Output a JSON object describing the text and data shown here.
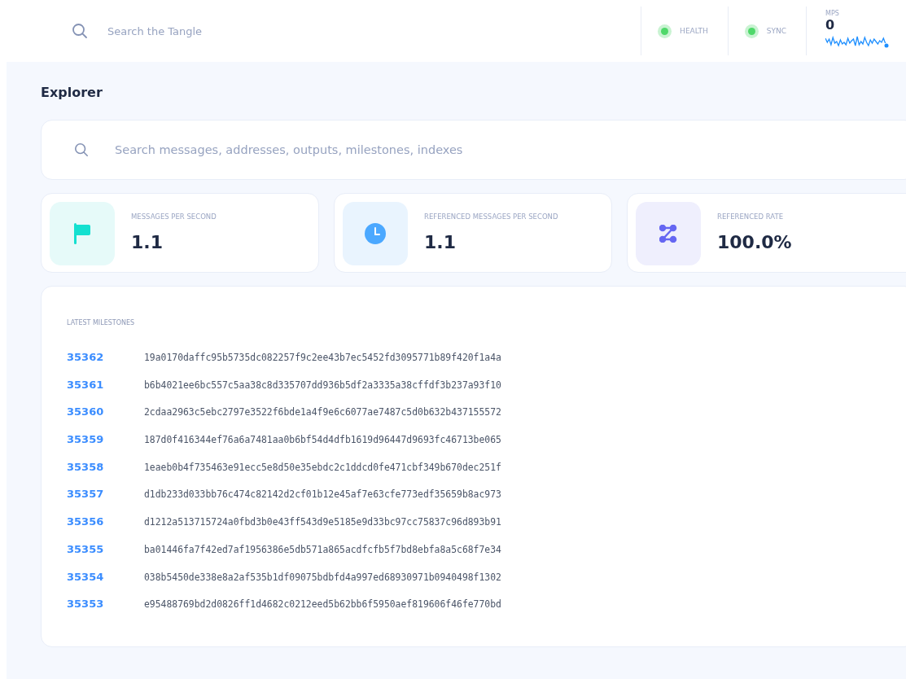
{
  "header": {
    "search": {
      "placeholder": "Search the Tangle"
    },
    "statuses": [
      {
        "label": "HEALTH",
        "healthy": true
      },
      {
        "label": "SYNC",
        "healthy": true
      }
    ],
    "mps": {
      "label": "MPS",
      "value": "0"
    }
  },
  "page_title": "Explorer",
  "search": {
    "placeholder": "Search messages, addresses, outputs, milestones, indexes"
  },
  "stats": [
    {
      "kind": "flag",
      "label": "MESSAGES PER SECOND",
      "value": "1.1"
    },
    {
      "kind": "clock",
      "label": "REFERENCED MESSAGES PER SECOND",
      "value": "1.1"
    },
    {
      "kind": "nodes",
      "label": "REFERENCED RATE",
      "value": "100.0%"
    }
  ],
  "milestones": {
    "title": "LATEST MILESTONES",
    "rows": [
      {
        "index": "35362",
        "id": "19a0170daffc95b5735dc082257f9c2ee43b7ec5452fd3095771b89f420f1a4a"
      },
      {
        "index": "35361",
        "id": "b6b4021ee6bc557c5aa38c8d335707dd936b5df2a3335a38cffdf3b237a93f10"
      },
      {
        "index": "35360",
        "id": "2cdaa2963c5ebc2797e3522f6bde1a4f9e6c6077ae7487c5d0b632b437155572"
      },
      {
        "index": "35359",
        "id": "187d0f416344ef76a6a7481aa0b6bf54d4dfb1619d96447d9693fc46713be065"
      },
      {
        "index": "35358",
        "id": "1eaeb0b4f735463e91ecc5e8d50e35ebdc2c1ddcd0fe471cbf349b670dec251f"
      },
      {
        "index": "35357",
        "id": "d1db233d033bb76c474c82142d2cf01b12e45af7e63cfe773edf35659b8ac973"
      },
      {
        "index": "35356",
        "id": "d1212a513715724a0fbd3b0e43ff543d9e5185e9d33bc97cc75837c96d893b91"
      },
      {
        "index": "35355",
        "id": "ba01446fa7f42ed7af1956386e5db571a865acdfcfb5f7bd8ebfa8a5c68f7e34"
      },
      {
        "index": "35354",
        "id": "038b5450de338e8a2af535b1df09075bdbfd4a997ed68930971b0940498f1302"
      },
      {
        "index": "35353",
        "id": "e95488769bd2d0826ff1d4682c0212eed5b62bb6f5950aef819606f46fe770bd"
      }
    ]
  }
}
